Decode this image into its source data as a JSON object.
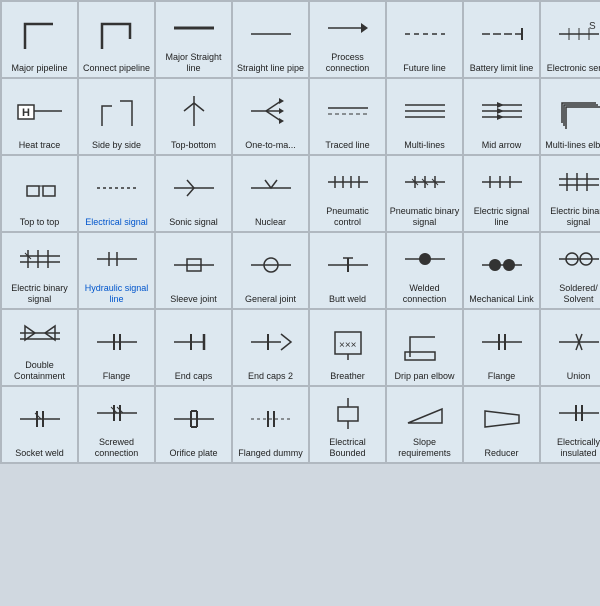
{
  "cells": [
    {
      "label": "Major pipeline",
      "icon": "major-pipeline"
    },
    {
      "label": "Connect pipeline",
      "icon": "connect-pipeline"
    },
    {
      "label": "Major Straight line",
      "icon": "major-straight-line"
    },
    {
      "label": "Straight line pipe",
      "icon": "straight-line-pipe"
    },
    {
      "label": "Process connection",
      "icon": "process-connection"
    },
    {
      "label": "Future line",
      "icon": "future-line"
    },
    {
      "label": "Battery limit line",
      "icon": "battery-limit-line"
    },
    {
      "label": "Electronic serial",
      "icon": "electronic-serial"
    },
    {
      "label": "Heat trace",
      "icon": "heat-trace"
    },
    {
      "label": "Side by side",
      "icon": "side-by-side"
    },
    {
      "label": "Top-bottom",
      "icon": "top-bottom"
    },
    {
      "label": "One-to-ma...",
      "icon": "one-to-many"
    },
    {
      "label": "Traced line",
      "icon": "traced-line"
    },
    {
      "label": "Multi-lines",
      "icon": "multi-lines"
    },
    {
      "label": "Mid arrow",
      "icon": "mid-arrow"
    },
    {
      "label": "Multi-lines elbow",
      "icon": "multi-lines-elbow"
    },
    {
      "label": "Top to top",
      "icon": "top-to-top"
    },
    {
      "label": "Electrical signal",
      "icon": "electrical-signal",
      "labelColor": "blue"
    },
    {
      "label": "Sonic signal",
      "icon": "sonic-signal"
    },
    {
      "label": "Nuclear",
      "icon": "nuclear"
    },
    {
      "label": "Pneumatic control",
      "icon": "pneumatic-control"
    },
    {
      "label": "Pneumatic binary signal",
      "icon": "pneumatic-binary-signal"
    },
    {
      "label": "Electric signal line",
      "icon": "electric-signal-line"
    },
    {
      "label": "Electric binary signal",
      "icon": "electric-binary-signal2"
    },
    {
      "label": "Electric binary signal",
      "icon": "electric-binary-signal"
    },
    {
      "label": "Hydraulic signal line",
      "icon": "hydraulic-signal-line",
      "labelColor": "blue"
    },
    {
      "label": "Sleeve joint",
      "icon": "sleeve-joint"
    },
    {
      "label": "General joint",
      "icon": "general-joint"
    },
    {
      "label": "Butt weld",
      "icon": "butt-weld"
    },
    {
      "label": "Welded connection",
      "icon": "welded-connection"
    },
    {
      "label": "Mechanical Link",
      "icon": "mechanical-link"
    },
    {
      "label": "Soldered/ Solvent",
      "icon": "soldered-solvent"
    },
    {
      "label": "Double Containment",
      "icon": "double-containment"
    },
    {
      "label": "Flange",
      "icon": "flange"
    },
    {
      "label": "End caps",
      "icon": "end-caps"
    },
    {
      "label": "End caps 2",
      "icon": "end-caps-2"
    },
    {
      "label": "Breather",
      "icon": "breather"
    },
    {
      "label": "Drip pan elbow",
      "icon": "drip-pan-elbow"
    },
    {
      "label": "Flange",
      "icon": "flange2"
    },
    {
      "label": "Union",
      "icon": "union"
    },
    {
      "label": "Socket weld",
      "icon": "socket-weld"
    },
    {
      "label": "Screwed connection",
      "icon": "screwed-connection"
    },
    {
      "label": "Orifice plate",
      "icon": "orifice-plate"
    },
    {
      "label": "Flanged dummy",
      "icon": "flanged-dummy"
    },
    {
      "label": "Electrical Bounded",
      "icon": "electrical-bounded"
    },
    {
      "label": "Slope requirements",
      "icon": "slope-requirements"
    },
    {
      "label": "Reducer",
      "icon": "reducer"
    },
    {
      "label": "Electrically insulated",
      "icon": "electrically-insulated"
    }
  ]
}
